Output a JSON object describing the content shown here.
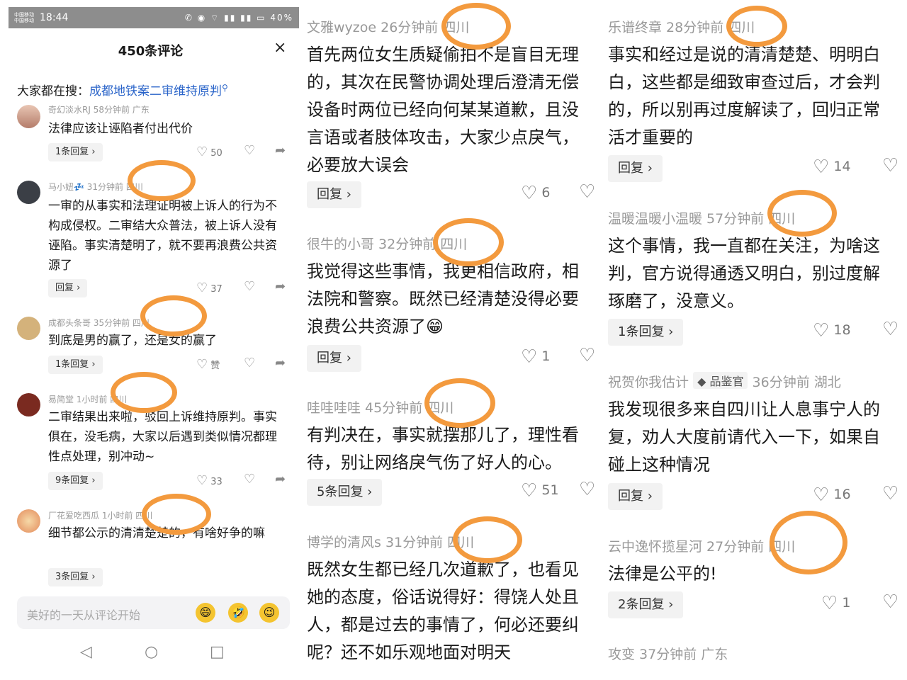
{
  "status": {
    "carrier": "中国移动 中国移动",
    "time": "18:44",
    "icons": "✆ ◉ ⌔ ▮▮ ▮▮ ▭ 40%"
  },
  "sheet": {
    "title": "450条评论",
    "close": "×"
  },
  "search": {
    "label": "大家都在搜：",
    "link": "成都地铁案二审维持原判"
  },
  "panel1": {
    "comments": [
      {
        "meta": "奇幻淡水RJ  58分钟前  广东",
        "text": "法律应该让诬陷者付出代价",
        "reply": "1条回复 ›",
        "likes": "50",
        "avatar_color": "#c8a79a"
      },
      {
        "meta": "马小妞💤  31分钟前  四川",
        "text": "一审的从事实和法理证明被上诉人的行为不构成侵权。二审结大众普法，被上诉人没有诬陷。事实清楚明了，就不要再浪费公共资源了",
        "reply": "回复 ›",
        "likes": "37",
        "avatar_color": "#3b3f46"
      },
      {
        "meta": "成都头条哥  35分钟前  四川",
        "text": "到底是男的赢了，还是女的赢了",
        "reply": "1条回复 ›",
        "likes": "赞",
        "avatar_color": "#d4b27b"
      },
      {
        "meta": "易简堂  1小时前  四川",
        "text": "二审结果出来啦，驳回上诉维持原判。事实俱在，没毛病，大家以后遇到类似情况都理性点处理，别冲动~",
        "reply": "9条回复 ›",
        "likes": "33",
        "avatar_color": "#7a2a20"
      },
      {
        "meta": "厂花爱吃西瓜  1小时前  四川",
        "text": "细节都公示的清清楚楚的，有啥好争的嘛",
        "reply": "3条回复 ›",
        "likes": "",
        "avatar_color": "#e7a26d"
      }
    ],
    "input_placeholder": "美好的一天从评论开始",
    "nav": {
      "back": "◁",
      "home": "○",
      "recent": "□"
    }
  },
  "panel2": {
    "comments": [
      {
        "meta": "文雅wyzoe  26分钟前  四川",
        "lines": [
          "首先两位女生质疑偷拍不是盲目无理",
          "的，其次在民警协调处理后澄清无偿",
          "设备时两位已经向何某某道歉，且没",
          "言语或者肢体攻击，大家少点戾气，",
          "必要放大误会"
        ],
        "reply": "回复 ›",
        "likes": "6"
      },
      {
        "meta": "很牛的小哥  32分钟前  四川",
        "lines": [
          "我觉得这些事情，我更相信政府，相",
          "法院和警察。既然已经清楚没得必要",
          "浪费公共资源了😁"
        ],
        "reply": "回复 ›",
        "likes": "1"
      },
      {
        "meta": "哇哇哇哇  45分钟前  四川",
        "lines": [
          "有判决在，事实就摆那儿了，理性看",
          "待，别让网络戾气伤了好人的心。"
        ],
        "reply": "5条回复 ›",
        "likes": "51"
      },
      {
        "meta": "博学的清风s  31分钟前  四川",
        "lines": [
          "既然女生都已经几次道歉了，也看见",
          "她的态度，俗话说得好：得饶人处且",
          "人，都是过去的事情了，何必还要纠",
          "呢？还不如乐观地面对明天"
        ],
        "reply": "",
        "likes": ""
      }
    ]
  },
  "panel3": {
    "comments": [
      {
        "meta": "乐谱终章  28分钟前  四川",
        "tag": "",
        "lines": [
          "事实和经过是说的清清楚楚、明明白",
          "白，这些都是细致审查过后，才会判",
          "的，所以别再过度解读了，回归正常",
          "活才重要的"
        ],
        "reply": "回复 ›",
        "likes": "14"
      },
      {
        "meta": "温暖温暖小温暖  57分钟前  四川",
        "tag": "",
        "lines": [
          "这个事情，我一直都在关注，为啥这",
          "判，官方说得通透又明白，别过度解",
          "琢磨了，没意义。"
        ],
        "reply": "1条回复 ›",
        "likes": "18"
      },
      {
        "meta_pre": "祝贺你我估计",
        "tag": "◆ 品鉴官",
        "meta": "36分钟前  湖北",
        "lines": [
          "我发现很多来自四川让人息事宁人的",
          "复，劝人大度前请代入一下，如果自",
          "碰上这种情况"
        ],
        "reply": "回复 ›",
        "likes": "16"
      },
      {
        "meta": "云中逸怀揽星河  27分钟前  四川",
        "tag": "",
        "lines": [
          "法律是公平的!"
        ],
        "reply": "2条回复 ›",
        "likes": "1"
      },
      {
        "meta": "攻变  37分钟前  广东",
        "tag": "",
        "lines": [],
        "reply": "",
        "likes": ""
      }
    ]
  },
  "colors": {
    "highlight": "#f39a3e",
    "link": "#2a64c9",
    "meta": "#999999"
  },
  "icons": {
    "like": "heart-icon",
    "dislike": "broken-heart-icon",
    "share": "share-icon",
    "close": "close-icon"
  }
}
